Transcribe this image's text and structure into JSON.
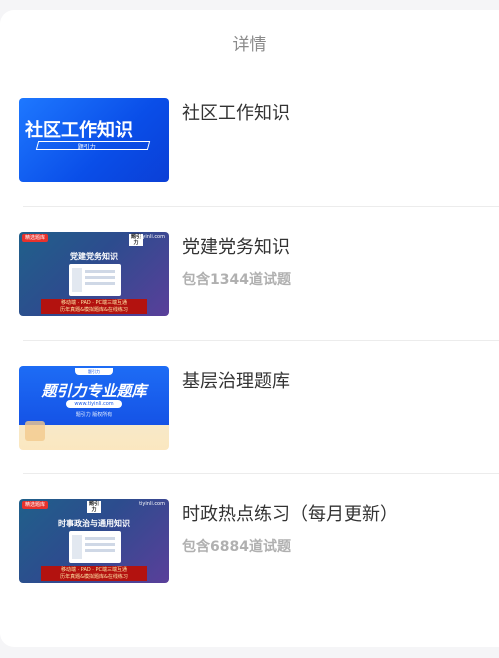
{
  "header": {
    "title": "详情"
  },
  "items": [
    {
      "title": "社区工作知识",
      "count": "",
      "thumb": {
        "main": "社区工作知识",
        "sub": "题引力"
      }
    },
    {
      "title": "党建党务知识",
      "count": "包含1344道试题",
      "thumb": {
        "tag": "精选题库",
        "logo": "题引力",
        "site": "tiyinli.com",
        "main": "党建党务知识",
        "line1": "移动端 · PAD · PC端三端互通",
        "line2": "历年真题&模拟题库&在线练习"
      }
    },
    {
      "title": "基层治理题库",
      "count": "",
      "thumb": {
        "chip": "题引力",
        "main": "题引力专业题库",
        "url": "www.tiyinli.com",
        "copy": "题引力 版权所有"
      }
    },
    {
      "title": "时政热点练习（每月更新）",
      "count": "包含6884道试题",
      "thumb": {
        "tag": "精选题库",
        "logo": "题引力",
        "site": "tiyinli.com",
        "main": "时事政治与通用知识",
        "line1": "移动端 · PAD · PC端三端互通",
        "line2": "历年真题&模拟题库&在线练习"
      }
    }
  ]
}
